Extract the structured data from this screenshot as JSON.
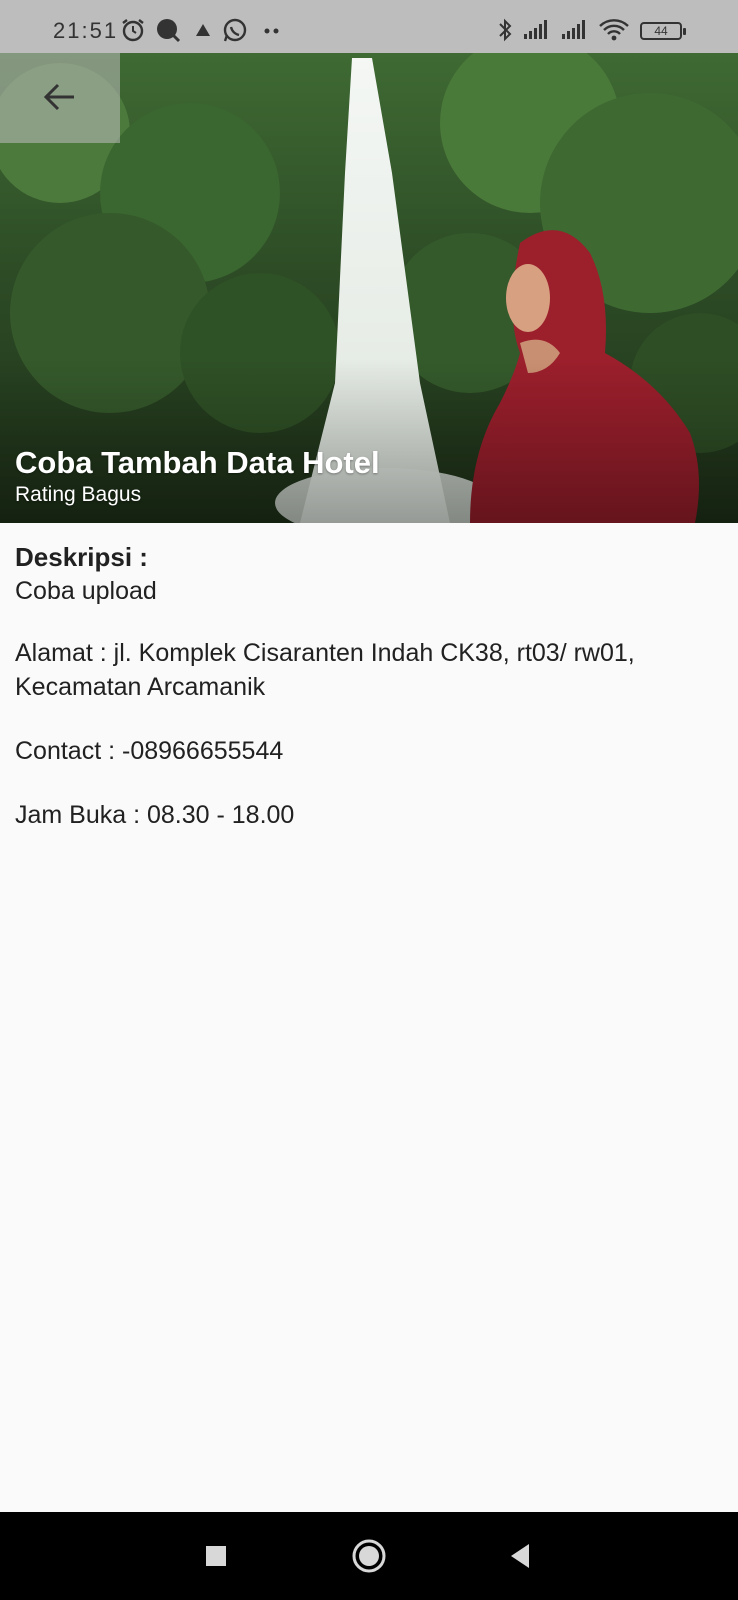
{
  "status_bar": {
    "time": "21:51",
    "battery": "44",
    "icons": [
      "alarm-icon",
      "chat-bubble-icon",
      "arrow-app-icon",
      "whatsapp-icon",
      "more-dots-icon",
      "bluetooth-icon",
      "signal-icon",
      "signal-icon",
      "wifi-icon",
      "battery-icon"
    ]
  },
  "header": {
    "back_icon": "arrow-left-icon",
    "title": "Coba Tambah Data Hotel",
    "subtitle": "Rating Bagus"
  },
  "details": {
    "description_heading": "Deskripsi :",
    "description_text": "Coba upload",
    "address": "Alamat : jl. Komplek Cisaranten Indah CK38, rt03/ rw01, Kecamatan Arcamanik",
    "contact": "Contact : -08966655544",
    "hours": "Jam Buka : 08.30 - 18.00"
  },
  "nav_bar": {
    "buttons": [
      "recents-square-icon",
      "home-circle-icon",
      "back-triangle-icon"
    ]
  },
  "colors": {
    "status_bar_bg": "#bdbdbd",
    "page_bg": "#fafafa",
    "text": "#212121",
    "nav_bar_bg": "#000000"
  }
}
